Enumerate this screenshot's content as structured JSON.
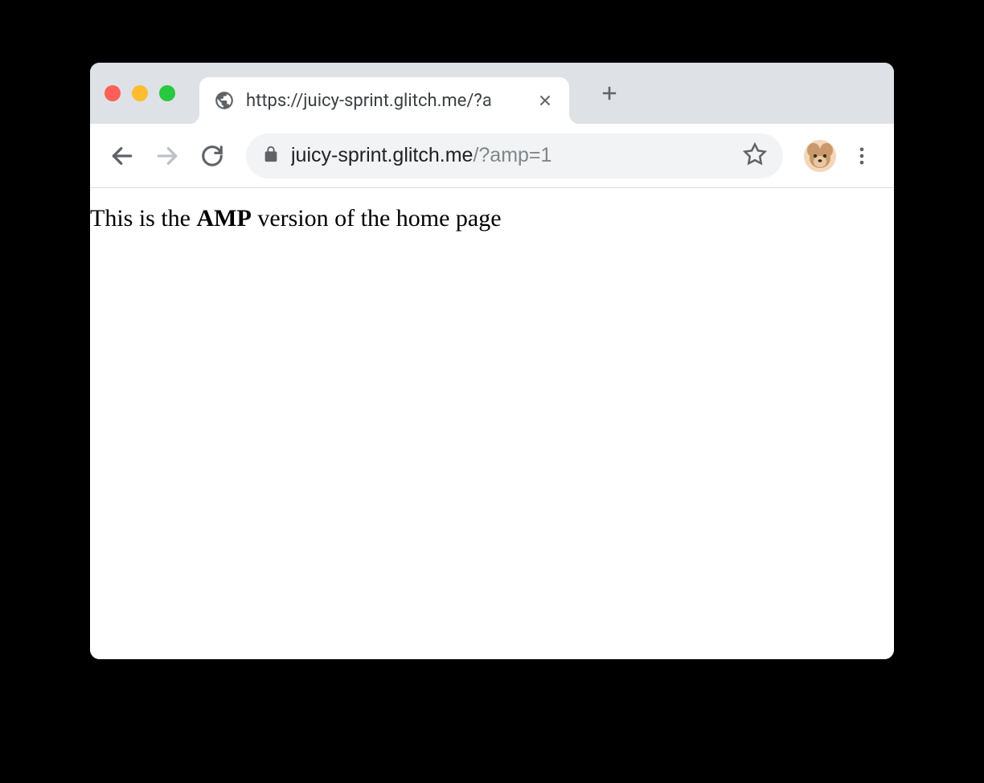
{
  "tab": {
    "title": "https://juicy-sprint.glitch.me/?a"
  },
  "addressBar": {
    "domain": "juicy-sprint.glitch.me",
    "path": "/?amp=1"
  },
  "page": {
    "text_before": "This is the ",
    "text_bold": "AMP",
    "text_after": " version of the home page"
  }
}
